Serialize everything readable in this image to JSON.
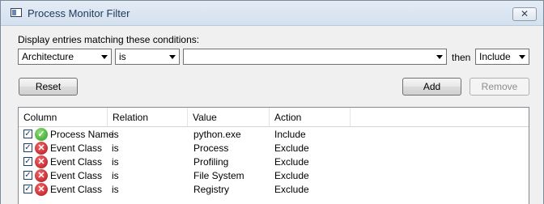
{
  "window": {
    "title": "Process Monitor Filter",
    "close_glyph": "✕"
  },
  "conditions": {
    "label": "Display entries matching these conditions:",
    "column_value": "Architecture",
    "relation_value": "is",
    "value_text": "",
    "then_label": "then",
    "action_value": "Include"
  },
  "buttons": {
    "reset": "Reset",
    "add": "Add",
    "remove": "Remove"
  },
  "table": {
    "headers": [
      "Column",
      "Relation",
      "Value",
      "Action"
    ],
    "rows": [
      {
        "checked": true,
        "status": "include",
        "column": "Process Name",
        "relation": "is",
        "value": "python.exe",
        "action": "Include"
      },
      {
        "checked": true,
        "status": "exclude",
        "column": "Event Class",
        "relation": "is",
        "value": "Process",
        "action": "Exclude"
      },
      {
        "checked": true,
        "status": "exclude",
        "column": "Event Class",
        "relation": "is",
        "value": "Profiling",
        "action": "Exclude"
      },
      {
        "checked": true,
        "status": "exclude",
        "column": "Event Class",
        "relation": "is",
        "value": "File System",
        "action": "Exclude"
      },
      {
        "checked": true,
        "status": "exclude",
        "column": "Event Class",
        "relation": "is",
        "value": "Registry",
        "action": "Exclude"
      }
    ]
  },
  "icons": {
    "check": "✓",
    "include": "✓",
    "exclude": "✕"
  }
}
